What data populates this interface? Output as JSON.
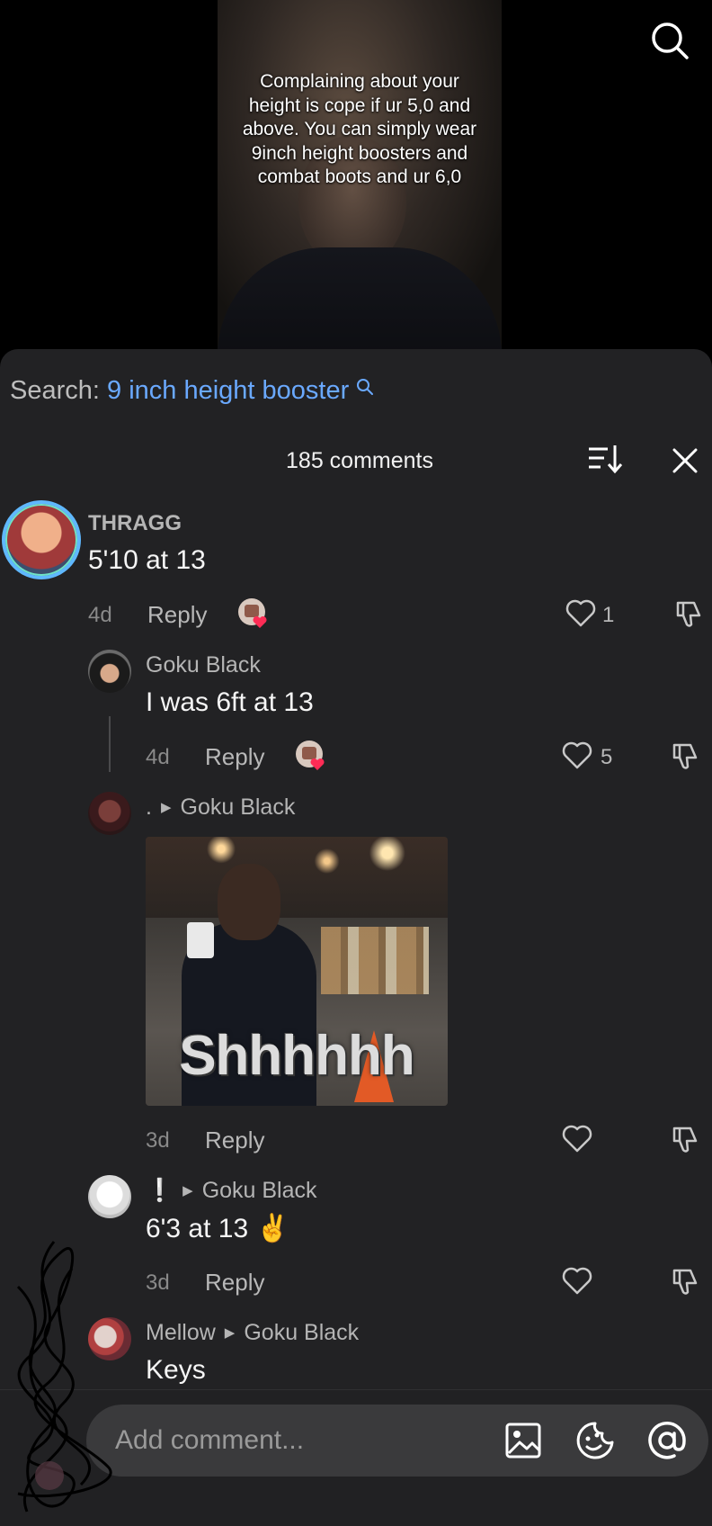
{
  "video": {
    "caption": "Complaining about your height is cope if ur 5,0 and above. You can simply wear 9inch height boosters and combat boots and ur 6,0"
  },
  "search": {
    "prefix": "Search:",
    "query": "9 inch height booster"
  },
  "header": {
    "count_label": "185 comments"
  },
  "comments": [
    {
      "username": "THRAGG",
      "text": "5'10 at 13",
      "time": "4d",
      "reply_label": "Reply",
      "likes": "1"
    },
    {
      "username": "Goku Black",
      "text": "I was 6ft at 13",
      "time": "4d",
      "reply_label": "Reply",
      "likes": "5"
    },
    {
      "username": ".",
      "reply_to": "Goku Black",
      "image_text": "Shhhhhh",
      "time": "3d",
      "reply_label": "Reply"
    },
    {
      "username": "❕",
      "reply_to": "Goku Black",
      "text": "6'3 at 13",
      "emoji": "✌",
      "time": "3d",
      "reply_label": "Reply"
    },
    {
      "username": "Mellow",
      "reply_to": "Goku Black",
      "text": "Keys"
    }
  ],
  "input": {
    "placeholder": "Add comment..."
  },
  "colors": {
    "link_blue": "#6aa9ff",
    "sheet_bg": "#222224",
    "like_red": "#fe2c55"
  },
  "icons": [
    "search-icon",
    "sort-icon",
    "close-icon",
    "heart-icon",
    "dislike-icon",
    "image-icon",
    "sticker-icon",
    "mention-icon"
  ]
}
